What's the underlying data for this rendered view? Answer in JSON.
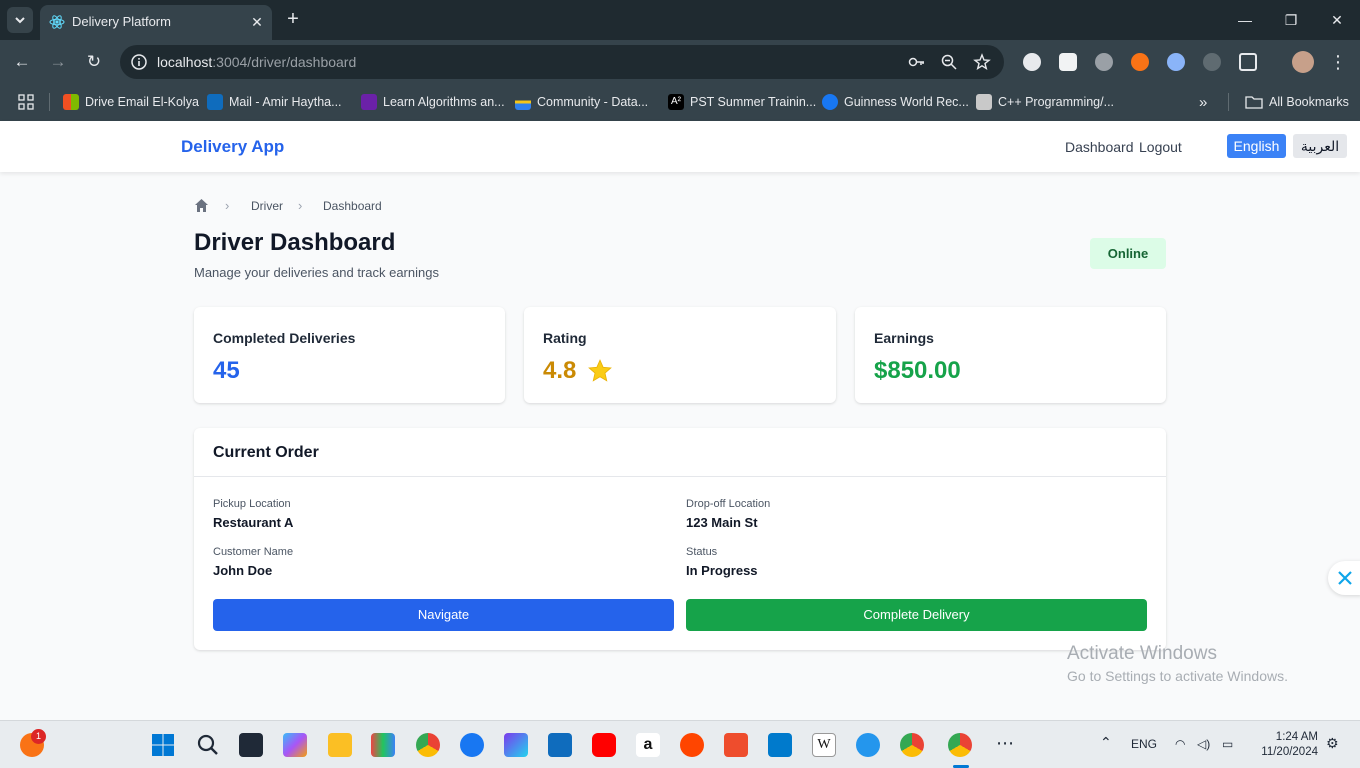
{
  "browser": {
    "tab_title": "Delivery Platform",
    "url_host": "localhost",
    "url_path": ":3004/driver/dashboard",
    "bookmarks": [
      "Drive Email El-Kolya",
      "Mail - Amir Haytha...",
      "Learn Algorithms an...",
      "Community - Data...",
      "PST Summer Trainin...",
      "Guinness World Rec...",
      "C++ Programming/..."
    ],
    "all_bookmarks": "All Bookmarks"
  },
  "app": {
    "brand": "Delivery App",
    "nav": {
      "dashboard": "Dashboard",
      "logout": "Logout"
    },
    "lang": {
      "english": "English",
      "arabic": "العربية"
    }
  },
  "breadcrumb": {
    "driver": "Driver",
    "dashboard": "Dashboard"
  },
  "header": {
    "title": "Driver Dashboard",
    "subtitle": "Manage your deliveries and track earnings",
    "status": "Online"
  },
  "stats": {
    "completed": {
      "label": "Completed Deliveries",
      "value": "45"
    },
    "rating": {
      "label": "Rating",
      "value": "4.8"
    },
    "earnings": {
      "label": "Earnings",
      "value": "$850.00"
    }
  },
  "order": {
    "title": "Current Order",
    "pickup_label": "Pickup Location",
    "pickup_value": "Restaurant A",
    "dropoff_label": "Drop-off Location",
    "dropoff_value": "123 Main St",
    "customer_label": "Customer Name",
    "customer_value": "John Doe",
    "status_label": "Status",
    "status_value": "In Progress",
    "navigate": "Navigate",
    "complete": "Complete Delivery"
  },
  "watermark": {
    "title": "Activate Windows",
    "subtitle": "Go to Settings to activate Windows."
  },
  "taskbar": {
    "lang": "ENG",
    "time": "1:24 AM",
    "date": "11/20/2024",
    "notification_badge": "1"
  },
  "colors": {
    "primary": "#2563eb",
    "success": "#16a34a",
    "rating": "#ca8a04"
  }
}
